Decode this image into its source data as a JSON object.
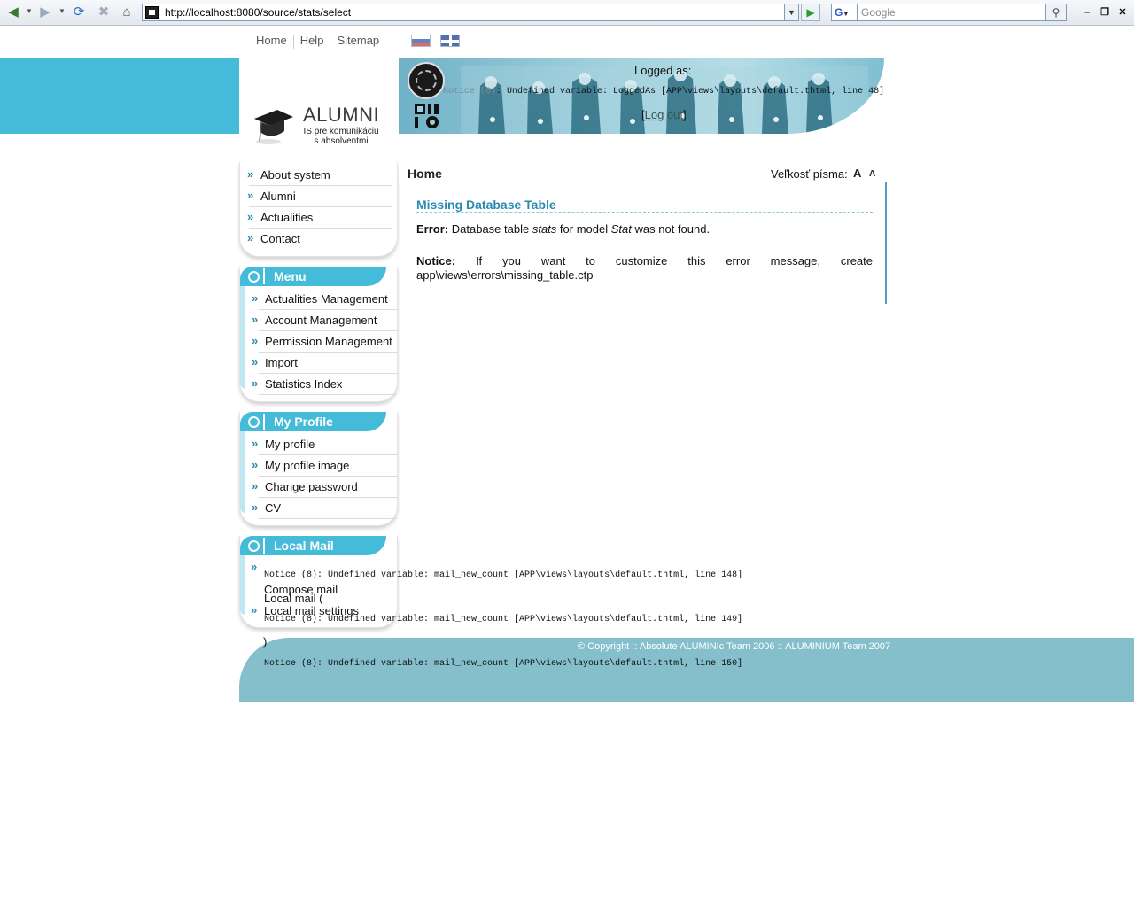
{
  "browser": {
    "url": "http://localhost:8080/source/stats/select",
    "search_placeholder": "Google",
    "search_engine": "G"
  },
  "topnav": [
    "Home",
    "Help",
    "Sitemap"
  ],
  "header": {
    "logo_title": "ALUMNI",
    "logo_sub_line1": "IS pre komunikáciu",
    "logo_sub_line2": "s absolventmi",
    "logged_as": "Logged as:",
    "notice_prefix": "Notice (8)",
    "notice_rest": ": Undefined variable: LoggedAs [APP\\views\\layouts\\default.thtml, line 48]",
    "logout_open": "[",
    "logout_label": "Log out",
    "logout_close": "]"
  },
  "sidebar": {
    "main_items": [
      "About system",
      "Alumni",
      "Actualities",
      "Contact"
    ],
    "menu_title": "Menu",
    "menu_items": [
      "Actualities Management",
      "Account Management",
      "Permission Management",
      "Import",
      "Statistics Index"
    ],
    "profile_title": "My Profile",
    "profile_items": [
      "My profile",
      "My profile image",
      "Change password",
      "CV"
    ],
    "mail_title": "Local Mail",
    "mail_compose": "Compose mail",
    "mail_local": "Local mail (",
    "mail_settings": "Local mail settings",
    "mail_close_paren": ")",
    "mail_notices": [
      "Notice (8): Undefined variable: mail_new_count [APP\\views\\layouts\\default.thtml, line 148]",
      "Notice (8): Undefined variable: mail_new_count [APP\\views\\layouts\\default.thtml, line 149]",
      "Notice (8): Undefined variable: mail_new_count [APP\\views\\layouts\\default.thtml, line 150]"
    ]
  },
  "content": {
    "breadcrumb": "Home",
    "font_size_label": "Veľkosť písma:",
    "font_up": "A",
    "font_down": "A",
    "error_title": "Missing Database Table",
    "error_label": "Error:",
    "error_text_1": "Database table",
    "error_table": "stats",
    "error_text_2": "for model",
    "error_model": "Stat",
    "error_text_3": "was not found.",
    "notice_label": "Notice:",
    "notice_text": "If you want to customize this error message, create app\\views\\errors\\missing_table.ctp"
  },
  "footer": {
    "copyright": "© Copyright :: Absolute ALUMINIc Team 2006 :: ALUMINIUM Team 2007"
  },
  "colors": {
    "accent": "#44bbd9",
    "footer": "#85bfcc",
    "link_heading": "#2a8bb0"
  }
}
